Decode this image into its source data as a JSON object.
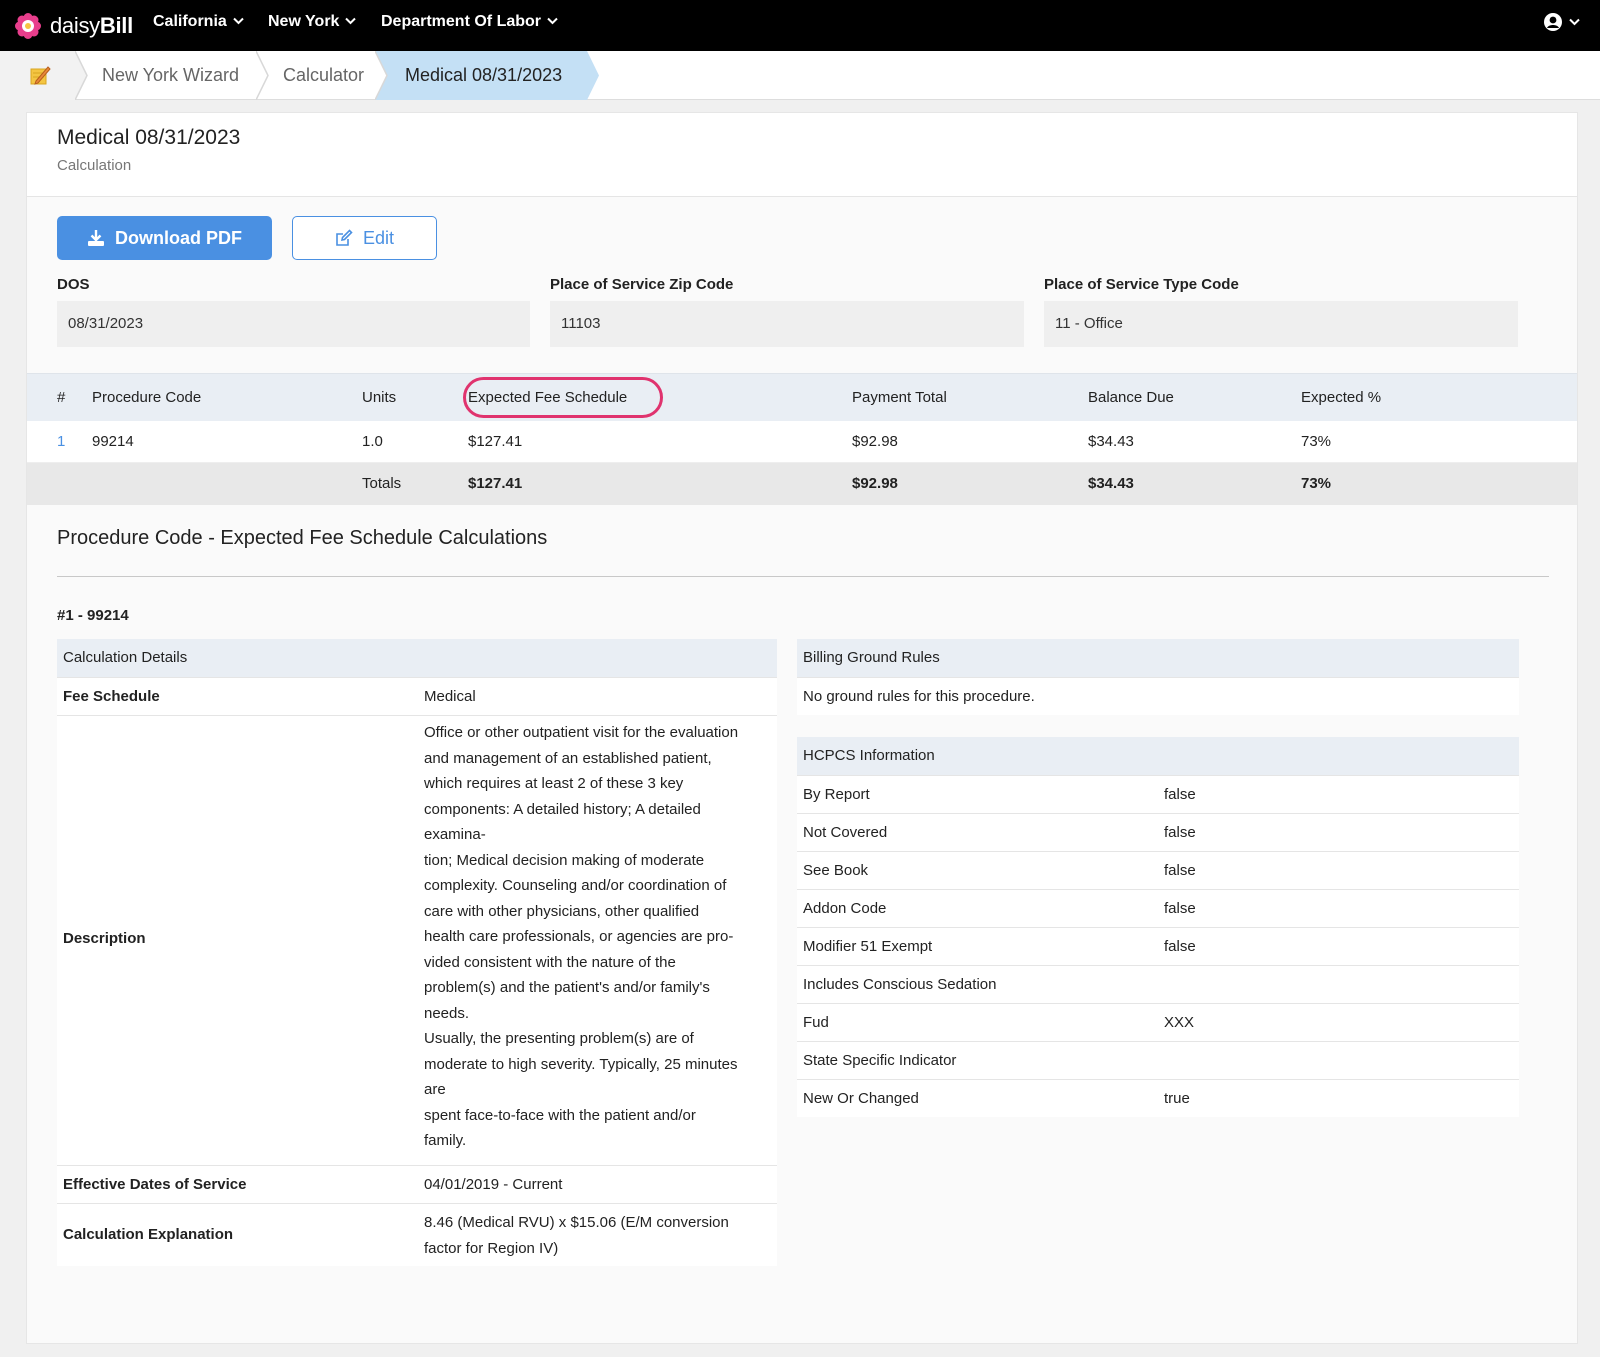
{
  "nav": {
    "brand_prefix": "daisy",
    "brand_suffix": "Bill",
    "items": [
      {
        "label": "California"
      },
      {
        "label": "New York"
      },
      {
        "label": "Department Of Labor"
      }
    ],
    "user_icon": "user-circle-icon"
  },
  "breadcrumb": {
    "home_icon": "pencil-notepad-icon",
    "items": [
      {
        "label": "New York Wizard"
      },
      {
        "label": "Calculator"
      },
      {
        "label": "Medical 08/31/2023"
      }
    ]
  },
  "page": {
    "title": "Medical 08/31/2023",
    "subtitle": "Calculation"
  },
  "actions": {
    "download_label": "Download PDF",
    "edit_label": "Edit"
  },
  "fields": {
    "dos_label": "DOS",
    "dos_value": "08/31/2023",
    "zip_label": "Place of Service Zip Code",
    "zip_value": "11103",
    "type_label": "Place of Service Type Code",
    "type_value": "11 - Office"
  },
  "procedures": {
    "headers": {
      "num": "#",
      "code": "Procedure Code",
      "units": "Units",
      "expected_fee": "Expected Fee Schedule",
      "payment_total": "Payment Total",
      "balance_due": "Balance Due",
      "expected_pct": "Expected %"
    },
    "rows": [
      {
        "num": "1",
        "code": "99214",
        "units": "1.0",
        "expected_fee": "$127.41",
        "payment_total": "$92.98",
        "balance_due": "$34.43",
        "expected_pct": "73%"
      }
    ],
    "totals": {
      "label": "Totals",
      "expected_fee": "$127.41",
      "payment_total": "$92.98",
      "balance_due": "$34.43",
      "expected_pct": "73%"
    }
  },
  "calculations": {
    "section_title": "Procedure Code - Expected Fee Schedule Calculations",
    "procedure_label": "#1 - 99214",
    "details": {
      "heading": "Calculation Details",
      "fee_schedule_label": "Fee Schedule",
      "fee_schedule_value": "Medical",
      "description_label": "Description",
      "description_lines": [
        "Office or other outpatient visit for the evaluation",
        "and management of an established patient,",
        "which requires at least 2 of these 3 key",
        "components: A detailed history; A detailed",
        "examina-",
        "tion; Medical decision making of moderate",
        "complexity. Counseling and/or coordination of",
        "care with other physicians, other qualified",
        "health care professionals, or agencies are pro-",
        "vided consistent with the nature of the",
        "problem(s) and the patient's and/or family's",
        "needs.",
        "Usually, the presenting problem(s) are of",
        "moderate to high severity. Typically, 25 minutes",
        "are",
        "spent face-to-face with the patient and/or",
        "family."
      ],
      "effective_label": "Effective Dates of Service",
      "effective_value": "04/01/2019 - Current",
      "explanation_label": "Calculation Explanation",
      "explanation_lines": [
        "8.46 (Medical RVU) x $15.06 (E/M conversion",
        "factor for Region IV)"
      ]
    },
    "ground_rules": {
      "heading": "Billing Ground Rules",
      "text": "No ground rules for this procedure."
    },
    "hcpcs": {
      "heading": "HCPCS Information",
      "rows": [
        {
          "label": "By Report",
          "value": "false"
        },
        {
          "label": "Not Covered",
          "value": "false"
        },
        {
          "label": "See Book",
          "value": "false"
        },
        {
          "label": "Addon Code",
          "value": "false"
        },
        {
          "label": "Modifier 51 Exempt",
          "value": "false"
        },
        {
          "label": "Includes Conscious Sedation",
          "value": ""
        },
        {
          "label": "Fud",
          "value": "XXX"
        },
        {
          "label": "State Specific Indicator",
          "value": ""
        },
        {
          "label": "New Or Changed",
          "value": "true"
        }
      ]
    }
  },
  "colors": {
    "nav_bg": "#000000",
    "primary": "#4a90e2",
    "breadcrumb_active": "#c4e0f5",
    "highlight": "#e0336e"
  }
}
